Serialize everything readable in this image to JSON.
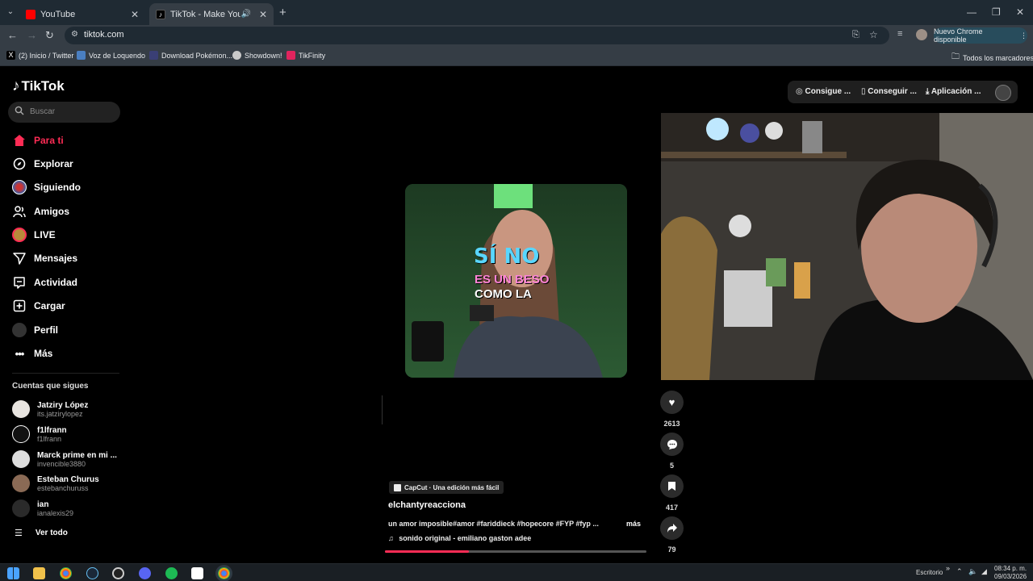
{
  "browser": {
    "tabs": [
      {
        "title": "YouTube",
        "icon": "youtube-icon",
        "color": "#ff0000"
      },
      {
        "title": "TikTok - Make Your Day",
        "icon": "tiktok-icon",
        "color": "#000000"
      }
    ],
    "url": "tiktok.com",
    "update_label": "Nuevo Chrome disponible",
    "bookmarks": [
      {
        "label": "(2) Inicio / Twitter",
        "icon": "x-icon"
      },
      {
        "label": "Voz de Loquendo",
        "icon": "loquendo-icon"
      },
      {
        "label": "Download Pokémon...",
        "icon": "pokemon-icon"
      },
      {
        "label": "Showdown!",
        "icon": "showdown-icon"
      },
      {
        "label": "TikFinity",
        "icon": "tikfinity-icon"
      }
    ],
    "all_bookmarks": "Todos los marcadores"
  },
  "tiktok": {
    "brand": "TikTok",
    "search_placeholder": "Buscar",
    "nav": [
      {
        "label": "Para ti",
        "icon": "home-icon"
      },
      {
        "label": "Explorar",
        "icon": "compass-icon"
      },
      {
        "label": "Siguiendo",
        "icon": "following-icon"
      },
      {
        "label": "Amigos",
        "icon": "friends-icon"
      },
      {
        "label": "LIVE",
        "icon": "live-icon"
      },
      {
        "label": "Mensajes",
        "icon": "send-icon"
      },
      {
        "label": "Actividad",
        "icon": "activity-icon"
      },
      {
        "label": "Cargar",
        "icon": "upload-icon"
      },
      {
        "label": "Perfil",
        "icon": "profile-icon"
      },
      {
        "label": "Más",
        "icon": "more-icon"
      }
    ],
    "following_title": "Cuentas que sigues",
    "accounts": [
      {
        "name": "Jatziry López",
        "handle": "its.jatzirylopez"
      },
      {
        "name": "f1lfrann",
        "handle": "f1lfrann"
      },
      {
        "name": "Marck prime en mi ...",
        "handle": "invencible3880"
      },
      {
        "name": "Esteban Churus",
        "handle": "estebanchuruss"
      },
      {
        "name": "ian",
        "handle": "ianalexis29"
      }
    ],
    "see_all": "Ver todo",
    "top_actions": [
      "Consigue ...",
      "Conseguir ...",
      "Aplicación ..."
    ],
    "video": {
      "caption_lines": [
        "SÍ NO",
        "ES UN BESO",
        "COMO LA"
      ],
      "capcut": "CapCut · Una edición más fácil",
      "author": "elchantyreacciona",
      "description": "un amor imposible#amor #fariddieck #hopecore #FYP #fyp ...",
      "more": "más",
      "sound": "sonido original - emiliano gaston adee",
      "progress": 0.32
    },
    "actions": [
      {
        "icon": "heart-icon",
        "count": "2613"
      },
      {
        "icon": "comment-icon",
        "count": "5"
      },
      {
        "icon": "bookmark-icon",
        "count": "417"
      },
      {
        "icon": "share-icon",
        "count": "79"
      }
    ]
  },
  "taskbar": {
    "desktop_label": "Escritorio",
    "time": "08:34 p. m.",
    "date": "09/03/2026"
  },
  "colors": {
    "accent": "#fe2c55",
    "tab_strip": "#1f2a33",
    "toolbar": "#353d45"
  }
}
